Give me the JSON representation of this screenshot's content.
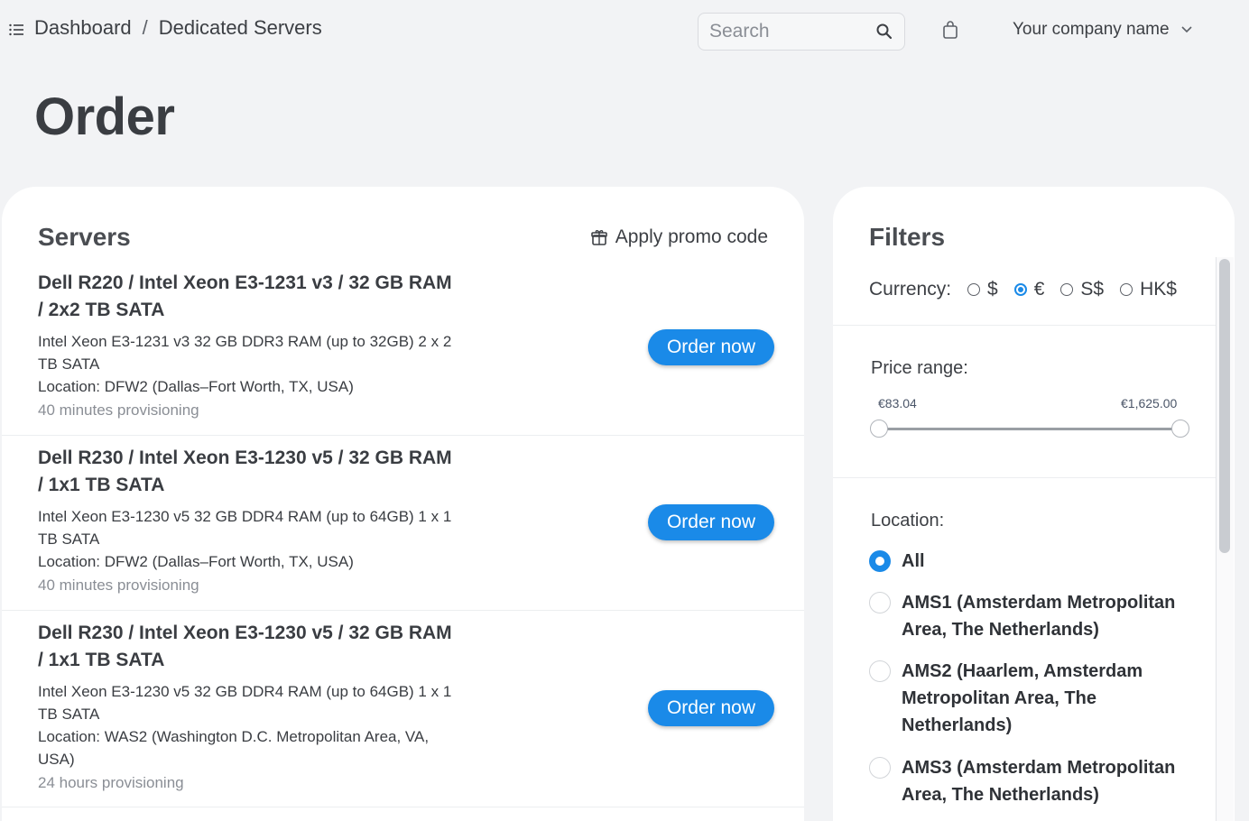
{
  "header": {
    "breadcrumb": [
      "Dashboard",
      "Dedicated Servers"
    ],
    "breadcrumb_separator": "/",
    "search_placeholder": "Search",
    "company_name": "Your company name"
  },
  "page": {
    "title": "Order"
  },
  "servers": {
    "title": "Servers",
    "promo_label": "Apply promo code",
    "order_button_label": "Order now",
    "items": [
      {
        "name": "Dell R220 / Intel Xeon E3-1231 v3 / 32 GB RAM / 2x2 TB SATA",
        "description": "Intel Xeon E3-1231 v3 32 GB DDR3 RAM (up to 32GB) 2 x 2 TB SATA",
        "location": "Location: DFW2 (Dallas–Fort Worth, TX, USA)",
        "provisioning": "40 minutes provisioning"
      },
      {
        "name": "Dell R230 / Intel Xeon E3-1230 v5 / 32 GB RAM / 1x1 TB SATA",
        "description": "Intel Xeon E3-1230 v5 32 GB DDR4 RAM (up to 64GB) 1 x 1 TB SATA",
        "location": "Location: DFW2 (Dallas–Fort Worth, TX, USA)",
        "provisioning": "40 minutes provisioning"
      },
      {
        "name": "Dell R230 / Intel Xeon E3-1230 v5 / 32 GB RAM / 1x1 TB SATA",
        "description": "Intel Xeon E3-1230 v5 32 GB DDR4 RAM (up to 64GB) 1 x 1 TB SATA",
        "location": "Location: WAS2 (Washington D.C. Metropolitan Area, VA, USA)",
        "provisioning": "24 hours provisioning"
      }
    ]
  },
  "filters": {
    "title": "Filters",
    "currency_label": "Currency:",
    "currencies": [
      "$",
      "€",
      "S$",
      "HK$"
    ],
    "selected_currency": "€",
    "price_range_label": "Price range:",
    "price_min": "€83.04",
    "price_max": "€1,625.00",
    "location_label": "Location:",
    "locations": [
      "All",
      "AMS1 (Amsterdam Metropolitan Area, The Netherlands)",
      "AMS2 (Haarlem, Amsterdam Metropolitan Area, The Netherlands)",
      "AMS3 (Amsterdam Metropolitan Area, The Netherlands)"
    ],
    "selected_location": "All"
  },
  "colors": {
    "accent": "#1a8ae8",
    "background": "#f2f3f5",
    "panel": "#ffffff"
  },
  "icons": [
    "menu-icon",
    "search-icon",
    "shopping-bag-icon",
    "chevron-down-icon",
    "gift-icon"
  ]
}
